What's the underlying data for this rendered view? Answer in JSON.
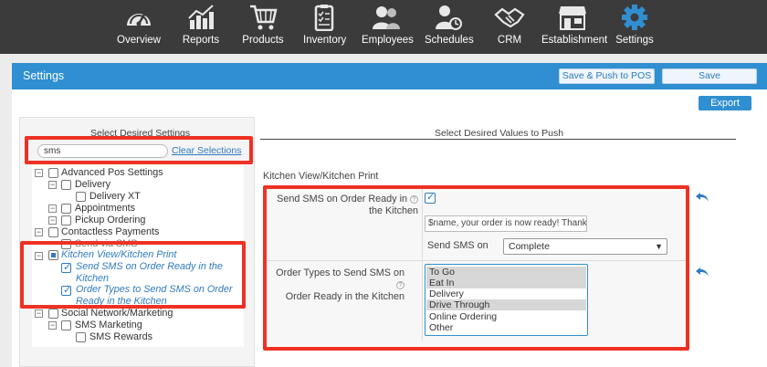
{
  "nav": [
    {
      "label": "Overview",
      "icon": "speedometer-icon"
    },
    {
      "label": "Reports",
      "icon": "bar-chart-icon"
    },
    {
      "label": "Products",
      "icon": "cart-icon"
    },
    {
      "label": "Inventory",
      "icon": "clipboard-icon"
    },
    {
      "label": "Employees",
      "icon": "people-icon"
    },
    {
      "label": "Schedules",
      "icon": "person-clock-icon"
    },
    {
      "label": "CRM",
      "icon": "handshake-icon"
    },
    {
      "label": "Establishment",
      "icon": "store-icon"
    },
    {
      "label": "Settings",
      "icon": "gear-icon"
    }
  ],
  "header": {
    "title": "Settings",
    "save_push_label": "Save & Push to POS",
    "save_label": "Save",
    "export_label": "Export"
  },
  "left": {
    "heading": "Select Desired Settings",
    "search_value": "sms",
    "clear_label": "Clear Selections",
    "tree": {
      "advanced": "Advanced Pos Settings",
      "delivery": "Delivery",
      "delivery_xt": "Delivery XT",
      "appointments": "Appointments",
      "pickup": "Pickup Ordering",
      "contactless": "Contactless Payments",
      "send_via_sms": "Send via SMS",
      "kitchen": "Kitchen View/Kitchen Print",
      "send_sms_ready_1": "Send SMS on Order Ready in the",
      "send_sms_ready_2": "Kitchen",
      "order_types_1": "Order Types to Send SMS on Order",
      "order_types_2": "Ready in the Kitchen",
      "social": "Social Network/Marketing",
      "sms_marketing": "SMS Marketing",
      "sms_rewards": "SMS Rewards"
    }
  },
  "right": {
    "heading": "Select Desired Values to Push",
    "section": "Kitchen View/Kitchen Print",
    "field1_label_1": "Send SMS on Order Ready in",
    "field1_label_2": "the Kitchen",
    "message_value": "$name, your order is now ready! Thank y",
    "send_sms_on_label": "Send SMS on",
    "send_sms_on_value": "Complete",
    "field2_label_1": "Order Types to Send SMS on",
    "field2_label_2": "Order Ready in the Kitchen",
    "order_types": [
      {
        "label": "To Go",
        "selected": true
      },
      {
        "label": "Eat In",
        "selected": true
      },
      {
        "label": "Delivery",
        "selected": false
      },
      {
        "label": "Drive Through",
        "selected": true
      },
      {
        "label": "Online Ordering",
        "selected": false
      },
      {
        "label": "Other",
        "selected": false
      }
    ]
  },
  "colors": {
    "nav_bg": "#3b3b3b",
    "accent": "#2f8fd0",
    "highlight": "#ee3124"
  }
}
